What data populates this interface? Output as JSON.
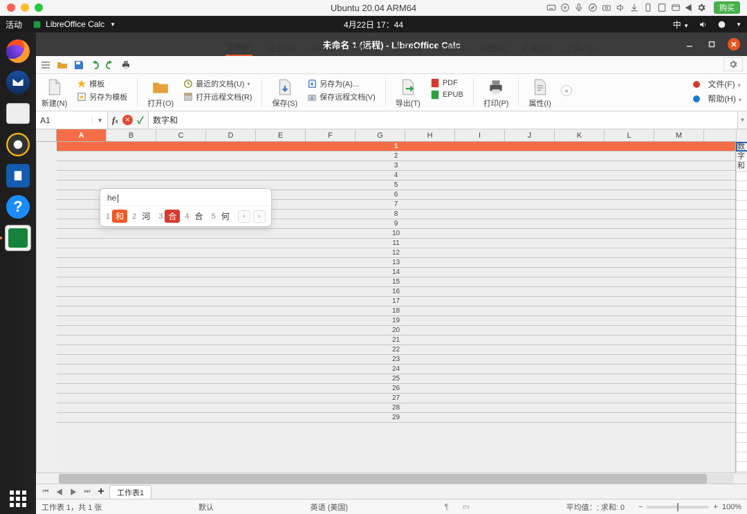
{
  "mac": {
    "title": "Ubuntu 20.04 ARM64",
    "buy_label": "购买"
  },
  "ubuntu_panel": {
    "activities": "活动",
    "app_name": "LibreOffice Calc",
    "clock": "4月22日  17：44",
    "input_method": "中"
  },
  "window": {
    "title": "未命名 1 (远程) - LibreOffice Calc"
  },
  "tabs": [
    {
      "label": "文件(F)",
      "active": true
    },
    {
      "label": "主页(H)",
      "active": false
    },
    {
      "label": "插入(I)",
      "active": false
    },
    {
      "label": "布局(L)",
      "active": false
    },
    {
      "label": "数据(D)",
      "active": false
    },
    {
      "label": "审阅(R)",
      "active": false
    },
    {
      "label": "视图(V)",
      "active": false
    },
    {
      "label": "扩展(X)",
      "active": false
    },
    {
      "label": "工具(T)",
      "active": false
    }
  ],
  "ribbon": {
    "new_label": "新建(N)",
    "template_label": "模板",
    "save_as_template_label": "另存为模板",
    "open_label": "打开(O)",
    "recent_docs_label": "最近的文档(U)",
    "open_remote_label": "打开远程文档(R)",
    "save_label": "保存(S)",
    "save_as_label": "另存为(A)...",
    "save_remote_label": "保存远程文档(V)",
    "export_label": "导出(T)",
    "pdf_label": "PDF",
    "epub_label": "EPUB",
    "print_label": "打印(P)",
    "properties_label": "属性(I)",
    "file_label": "文件(F)",
    "help_label": "帮助(H)"
  },
  "formula_bar": {
    "name_box": "A1",
    "content": "数字和"
  },
  "sheet": {
    "columns": [
      "A",
      "B",
      "C",
      "D",
      "E",
      "F",
      "G",
      "H",
      "I",
      "J",
      "K",
      "L",
      "M"
    ],
    "row_count": 29,
    "cell_a1": "数字和"
  },
  "ime": {
    "input": "he",
    "candidates": [
      {
        "num": "1",
        "text": "和",
        "sel": true
      },
      {
        "num": "2",
        "text": "河"
      },
      {
        "num": "3",
        "text": "合",
        "red": true
      },
      {
        "num": "4",
        "text": "合"
      },
      {
        "num": "5",
        "text": "何"
      }
    ]
  },
  "sheet_tabs": {
    "tab1": "工作表1"
  },
  "status": {
    "sheet_info": "工作表 1，共 1 张",
    "style": "默认",
    "lang": "英语 (美国)",
    "calc": "平均值：; 求和: 0",
    "zoom": "100%"
  }
}
